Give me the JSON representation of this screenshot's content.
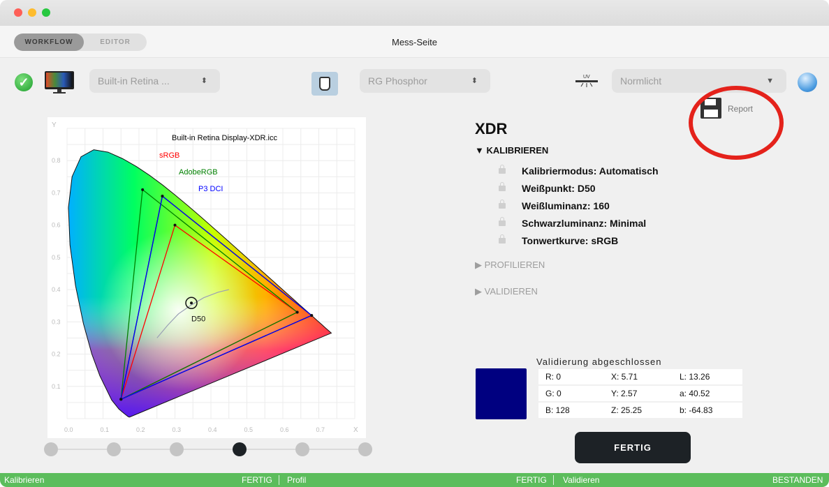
{
  "window": {
    "title": "Mess-Seite"
  },
  "mode_tabs": [
    {
      "label": "WORKFLOW",
      "active": true
    },
    {
      "label": "EDITOR",
      "active": false
    }
  ],
  "toolbar": {
    "display_select": "Built-in Retina ...",
    "phosphor_select": "RG Phosphor",
    "light_select": "Normlicht",
    "report_label": "Report",
    "uv_label": "UV"
  },
  "panel": {
    "device_name": "XDR",
    "calibrate_section": "▼ KALIBRIEREN",
    "settings": [
      {
        "label": "Kalibriermodus:",
        "value": "Automatisch"
      },
      {
        "label": "Weißpunkt:",
        "value": "D50"
      },
      {
        "label": "Weißluminanz:",
        "value": "160"
      },
      {
        "label": "Schwarzluminanz:",
        "value": "Minimal"
      },
      {
        "label": "Tonwertkurve:",
        "value": "sRGB"
      }
    ],
    "profile_section": "▶ PROFILIEREN",
    "validate_section": "▶ VALIDIEREN"
  },
  "validation": {
    "title": "Validierung abgeschlossen",
    "swatch_color": "#000080",
    "rows": [
      {
        "a": "R:  0",
        "b": "X:  5.71",
        "c": "L:  13.26"
      },
      {
        "a": "G:  0",
        "b": "Y:  2.57",
        "c": "a:  40.52"
      },
      {
        "a": "B:  128",
        "b": "Z:  25.25",
        "c": "b:  -64.83"
      }
    ]
  },
  "buttons": {
    "done": "FERTIG"
  },
  "progress": {
    "steps": 6,
    "current": 3
  },
  "statusbar": [
    {
      "name": "Kalibrieren",
      "state": "FERTIG"
    },
    {
      "name": "Profil",
      "state": "FERTIG"
    },
    {
      "name": "Validieren",
      "state": "BESTANDEN"
    }
  ],
  "chart_data": {
    "type": "scatter",
    "subtype": "CIE 1931 xy chromaticity diagram",
    "xlabel": "X",
    "ylabel": "Y",
    "xlim": [
      0.0,
      0.8
    ],
    "ylim": [
      0.0,
      0.9
    ],
    "xticks": [
      "0.0",
      "0.1",
      "0.2",
      "0.3",
      "0.4",
      "0.5",
      "0.6",
      "0.7"
    ],
    "yticks": [
      "0.1",
      "0.2",
      "0.3",
      "0.4",
      "0.5",
      "0.6",
      "0.7",
      "0.8"
    ],
    "grid": true,
    "series": [
      {
        "name": "Built-in Retina Display-XDR.icc",
        "color": "#000000",
        "points": [
          [
            0.68,
            0.32
          ],
          [
            0.265,
            0.69
          ],
          [
            0.15,
            0.06
          ]
        ]
      },
      {
        "name": "sRGB",
        "color": "#ff0000",
        "points": [
          [
            0.64,
            0.33
          ],
          [
            0.3,
            0.6
          ],
          [
            0.15,
            0.06
          ]
        ]
      },
      {
        "name": "AdobeRGB",
        "color": "#008000",
        "points": [
          [
            0.64,
            0.33
          ],
          [
            0.21,
            0.71
          ],
          [
            0.15,
            0.06
          ]
        ]
      },
      {
        "name": "P3 DCI",
        "color": "#0000ff",
        "points": [
          [
            0.68,
            0.32
          ],
          [
            0.265,
            0.69
          ],
          [
            0.15,
            0.06
          ]
        ]
      }
    ],
    "white_point": {
      "label": "D50",
      "x": 0.3457,
      "y": 0.3585
    }
  }
}
